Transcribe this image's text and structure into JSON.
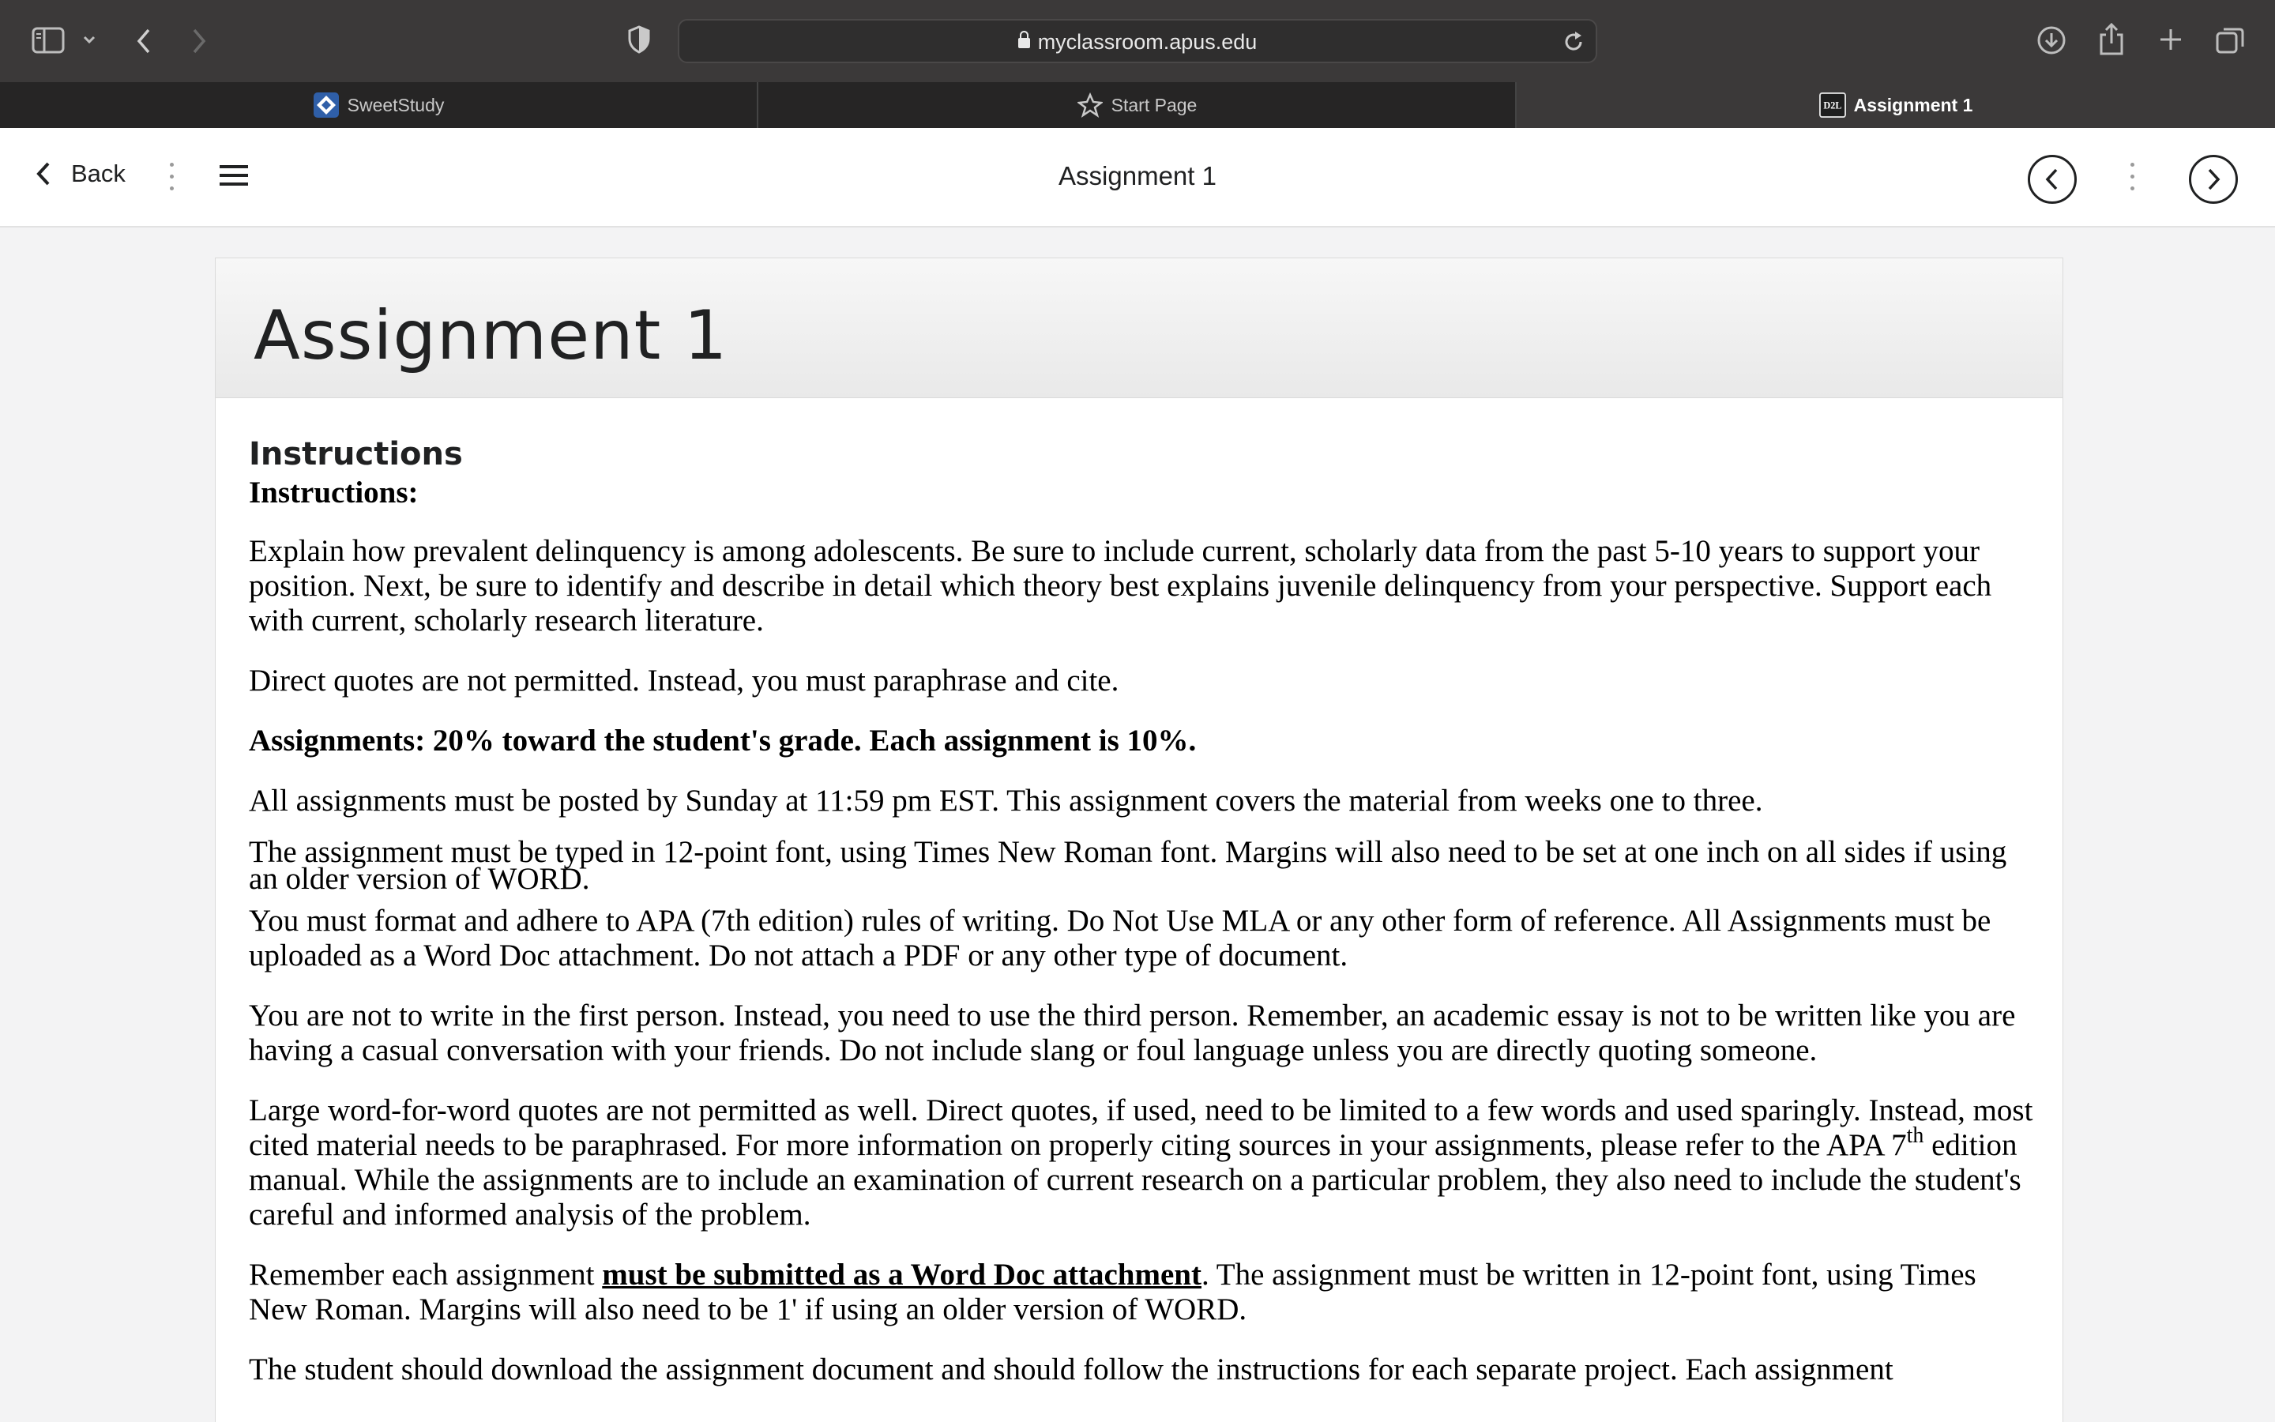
{
  "browser": {
    "url": "myclassroom.apus.edu",
    "tabs": [
      {
        "label": "SweetStudy"
      },
      {
        "label": "Start Page"
      },
      {
        "label": "Assignment 1",
        "favicon_text": "D2L"
      }
    ]
  },
  "header": {
    "back_label": "Back",
    "title": "Assignment 1"
  },
  "page": {
    "title": "Assignment 1",
    "section_heading": "Instructions",
    "instructions": {
      "heading": "Instructions:",
      "p1": "Explain how prevalent delinquency is among adolescents. Be sure to include current, scholarly data from the past 5-10 years to support your position. Next, be sure to identify and describe in detail which theory best explains juvenile delinquency from your perspective. Support each with current, scholarly research literature.",
      "p2": "Direct quotes are not permitted. Instead, you must paraphrase and cite.",
      "p3": "Assignments: 20% toward the student's grade. Each assignment is 10%.",
      "p4": "All assignments must be posted by Sunday at 11:59 pm EST. This assignment covers the material from weeks one to three.",
      "p5": "The assignment must be typed in 12-point font, using Times New Roman font. Margins will also need to be set at one inch on all sides if using an older version of WORD.",
      "p6": "You must format and adhere to APA (7th edition) rules of writing. Do Not Use MLA or any other form of reference. All Assignments must be uploaded as a Word Doc attachment. Do not attach a PDF or any other type of document.",
      "p7": "You are not to write in the first person. Instead, you need to use the third person. Remember, an academic essay is not to be written like you are having a casual conversation with your friends. Do not include slang or foul language unless you are directly quoting someone.",
      "p8_a": "Large word-for-word quotes are not permitted as well. Direct quotes, if used, need to be limited to a few words and used sparingly. Instead, most cited material needs to be paraphrased. For more information on properly citing sources in your assignments, please refer to the APA 7",
      "p8_sup": "th",
      "p8_b": " edition manual. While the assignments are to include an examination of current research on a particular problem, they also need to include the student's careful and informed analysis of the problem.",
      "p9_a": "Remember each assignment ",
      "p9_link": "must be submitted as a Word Doc attachment",
      "p9_b": ". The assignment must be written in 12-point font, using Times New Roman. Margins will also need to be 1' if using an older version of WORD.",
      "p10": "The student should download the assignment document and should follow the instructions for each separate project. Each assignment"
    }
  }
}
